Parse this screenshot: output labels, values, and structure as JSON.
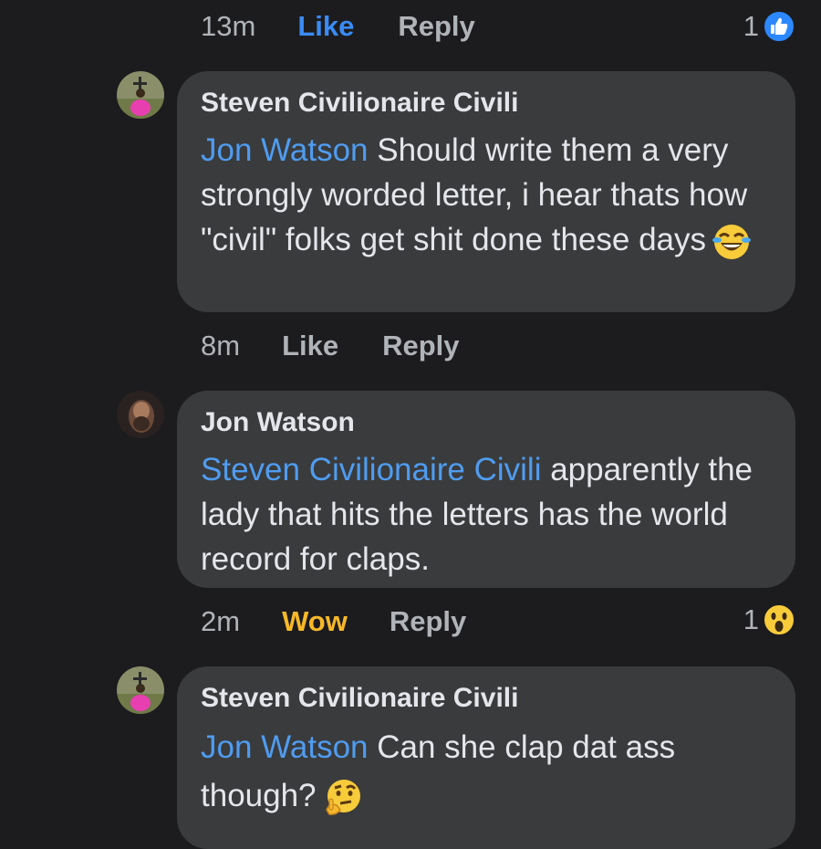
{
  "top_actions": {
    "time": "13m",
    "like": "Like",
    "reply": "Reply",
    "reaction_count": "1",
    "reaction_icon": "like-reaction-icon"
  },
  "comments": [
    {
      "author": "Steven Civilionaire Civili",
      "mention": "Jon Watson",
      "text": " Should write them a very strongly worded letter, i hear thats how \"civil\" folks get shit done these days",
      "emoji": "laughing-tears-emoji",
      "time": "8m",
      "like": "Like",
      "reply": "Reply"
    },
    {
      "author": "Jon Watson",
      "mention": "Steven Civilionaire Civili",
      "text": " apparently the lady that hits the letters has the world record for claps.",
      "time": "2m",
      "reaction_label": "Wow",
      "reply": "Reply",
      "reaction_count": "1",
      "reaction_icon": "wow-reaction-icon"
    },
    {
      "author": "Steven Civilionaire Civili",
      "mention": "Jon Watson",
      "text": " Can she clap dat ass though?",
      "emoji": "thinking-face-emoji"
    }
  ],
  "colors": {
    "background": "#1c1c1e",
    "bubble": "#3a3b3c",
    "link": "#4f9cf0",
    "like_active": "#3a8bf5",
    "wow": "#f7b928"
  }
}
